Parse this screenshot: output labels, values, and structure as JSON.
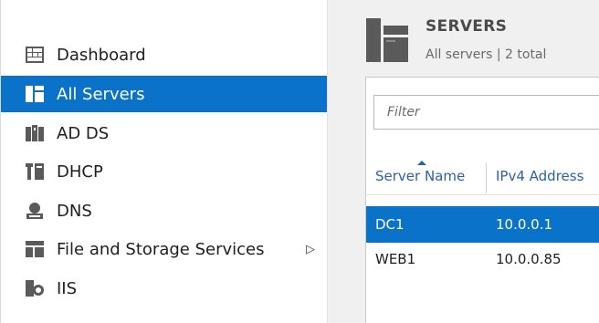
{
  "nav": {
    "items": [
      {
        "label": "Dashboard",
        "icon": "dashboard-icon",
        "selected": false
      },
      {
        "label": "All Servers",
        "icon": "all-servers-icon",
        "selected": true
      },
      {
        "label": "AD DS",
        "icon": "ad-ds-icon",
        "selected": false
      },
      {
        "label": "DHCP",
        "icon": "dhcp-icon",
        "selected": false
      },
      {
        "label": "DNS",
        "icon": "dns-icon",
        "selected": false
      },
      {
        "label": "File and Storage Services",
        "icon": "file-storage-icon",
        "selected": false,
        "has_submenu": true,
        "arrow": "▷"
      },
      {
        "label": "IIS",
        "icon": "iis-icon",
        "selected": false
      }
    ]
  },
  "header": {
    "title": "SERVERS",
    "subtitle": "All servers | 2 total"
  },
  "filter": {
    "placeholder": "Filter",
    "value": ""
  },
  "table": {
    "columns": [
      "Server Name",
      "IPv4 Address"
    ],
    "sorted_column": "Server Name",
    "rows": [
      {
        "name": "DC1",
        "ip": "10.0.0.1",
        "selected": true
      },
      {
        "name": "WEB1",
        "ip": "10.0.0.85",
        "selected": false
      }
    ]
  },
  "colors": {
    "selection": "#0a72c9",
    "link_blue": "#2a62a8",
    "pane_bg": "#f0f0f0"
  }
}
